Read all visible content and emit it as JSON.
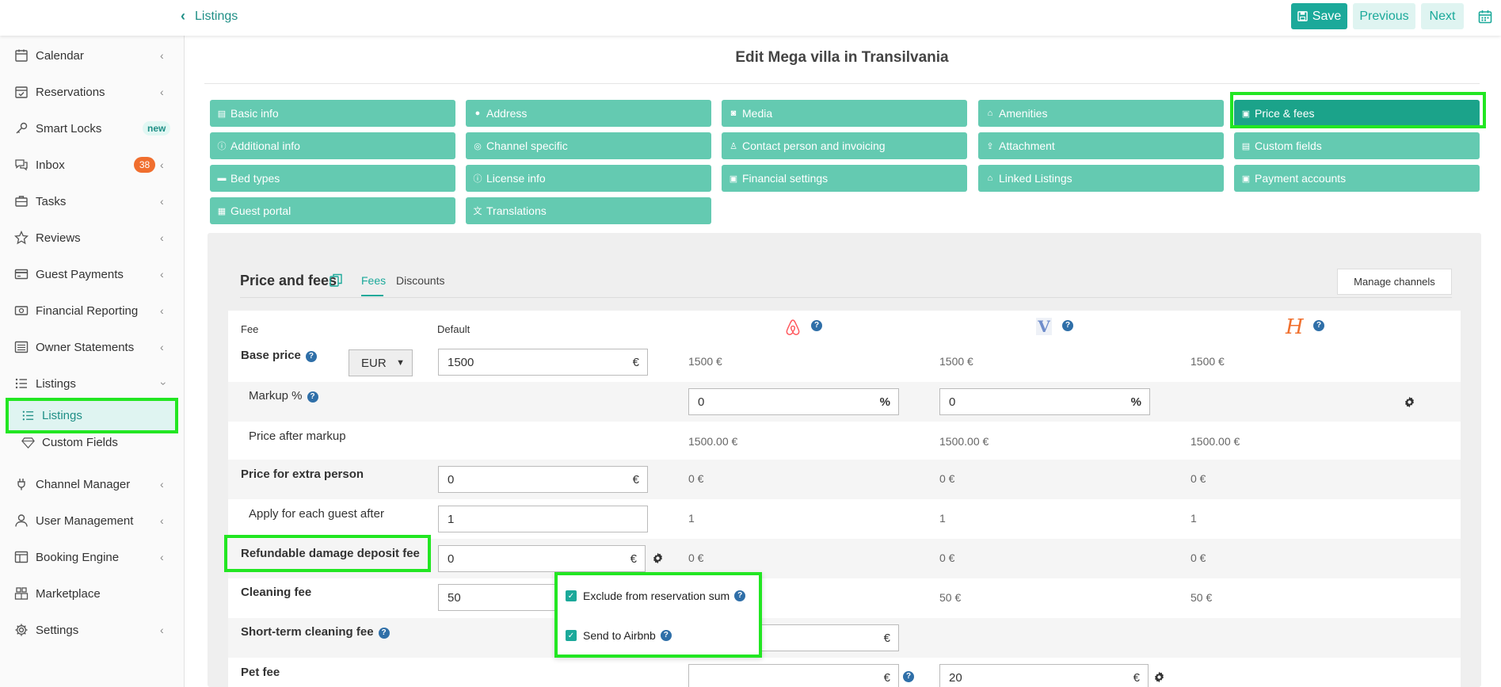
{
  "topbar": {
    "back_label": "Listings",
    "save_label": "Save",
    "previous_label": "Previous",
    "next_label": "Next"
  },
  "sidebar": {
    "items": [
      {
        "label": "Calendar",
        "icon": "calendar-icon"
      },
      {
        "label": "Reservations",
        "icon": "calendar-check-icon"
      },
      {
        "label": "Smart Locks",
        "icon": "key-icon",
        "badge": "new"
      },
      {
        "label": "Inbox",
        "icon": "chat-icon",
        "badge": "38"
      },
      {
        "label": "Tasks",
        "icon": "briefcase-icon"
      },
      {
        "label": "Reviews",
        "icon": "star-icon"
      },
      {
        "label": "Guest Payments",
        "icon": "credit-card-icon"
      },
      {
        "label": "Financial Reporting",
        "icon": "money-icon"
      },
      {
        "label": "Owner Statements",
        "icon": "list-icon"
      },
      {
        "label": "Listings",
        "icon": "list-bullet-icon"
      },
      {
        "label": "Channel Manager",
        "icon": "plug-icon"
      },
      {
        "label": "User Management",
        "icon": "user-icon"
      },
      {
        "label": "Booking Engine",
        "icon": "window-icon"
      },
      {
        "label": "Marketplace",
        "icon": "store-icon"
      },
      {
        "label": "Settings",
        "icon": "gear-icon"
      }
    ],
    "sub_items": [
      {
        "label": "Listings",
        "icon": "list-bullet-icon"
      },
      {
        "label": "Custom Fields",
        "icon": "diamond-icon"
      }
    ]
  },
  "page": {
    "title": "Edit Mega villa in Transilvania"
  },
  "tabs": [
    "Basic info",
    "Address",
    "Media",
    "Amenities",
    "Price & fees",
    "Additional info",
    "Channel specific",
    "Contact person and invoicing",
    "Attachment",
    "Custom fields",
    "Bed types",
    "License info",
    "Financial settings",
    "Linked Listings",
    "Payment accounts",
    "Guest portal",
    "Translations"
  ],
  "panel": {
    "title": "Price and fees",
    "tab_fees": "Fees",
    "tab_discounts": "Discounts",
    "manage_channels": "Manage channels"
  },
  "table": {
    "col_fee": "Fee",
    "col_default": "Default",
    "help": "?",
    "channels": [
      "airbnb-logo",
      "vrbo-logo",
      "homeaway-logo"
    ],
    "base_price": {
      "label": "Base price",
      "currency": "EUR",
      "value": "1500",
      "unit": "€",
      "ch1": "1500 €",
      "ch2": "1500 €",
      "ch3": "1500 €"
    },
    "markup": {
      "label": "Markup %",
      "ch1": "0",
      "ch2": "0",
      "unit": "%"
    },
    "price_after_markup": {
      "label": "Price after markup",
      "ch1": "1500.00 €",
      "ch2": "1500.00 €",
      "ch3": "1500.00 €"
    },
    "extra_person": {
      "label": "Price for extra person",
      "value": "0",
      "unit": "€",
      "ch1": "0 €",
      "ch2": "0 €",
      "ch3": "0 €"
    },
    "apply_guest": {
      "label": "Apply for each guest after",
      "value": "1",
      "ch1": "1",
      "ch2": "1",
      "ch3": "1"
    },
    "damage_deposit": {
      "label": "Refundable damage deposit fee",
      "value": "0",
      "unit": "€",
      "ch1": "0 €",
      "ch2": "0 €",
      "ch3": "0 €"
    },
    "cleaning": {
      "label": "Cleaning fee",
      "value": "50",
      "ch2": "50 €",
      "ch3": "50 €"
    },
    "short_cleaning": {
      "label": "Short-term cleaning fee",
      "unit": "€"
    },
    "pet": {
      "label": "Pet fee",
      "unit": "€",
      "ch2": "20"
    }
  },
  "popup": {
    "exclude_label": "Exclude from reservation sum",
    "send_label": "Send to Airbnb"
  }
}
